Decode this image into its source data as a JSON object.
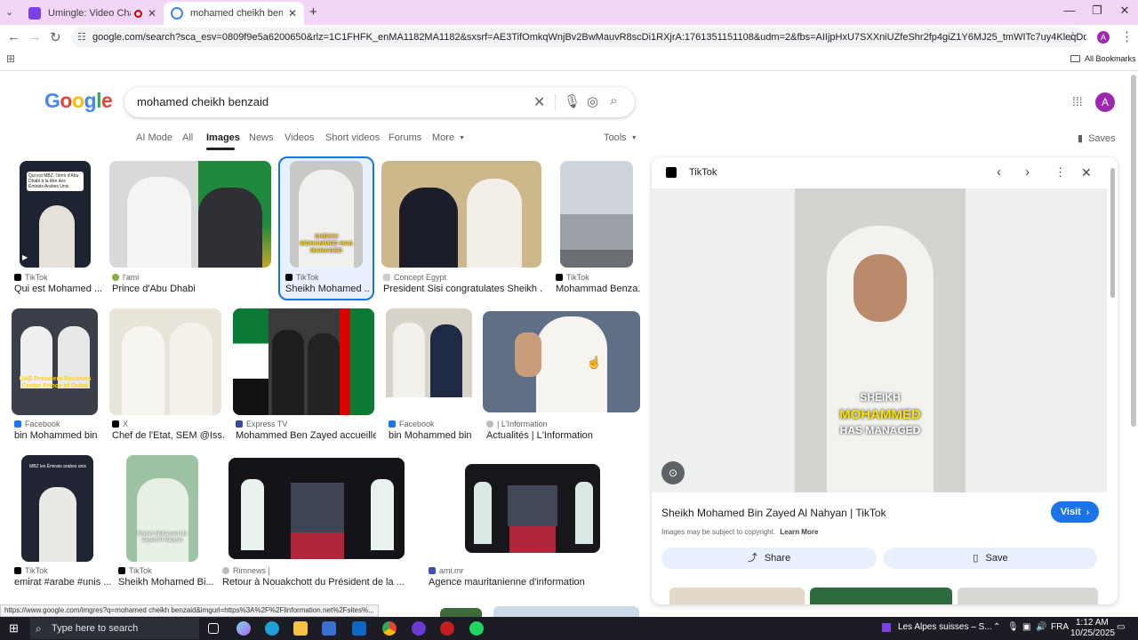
{
  "browser": {
    "tabs": [
      {
        "title": "Umingle: Video Chat with S",
        "active": false
      },
      {
        "title": "mohamed cheikh benzaid - Go",
        "active": true
      }
    ],
    "new_tab": "+",
    "url": "google.com/search?sca_esv=0809f9e5a6200650&rlz=1C1FHFK_enMA1182MA1182&sxsrf=AE3TifOmkqWnjBv2BwMauvR8scDi1RXjrA:1761351151108&udm=2&fbs=AIIjpHxU7SXXniUZfeShr2fp4giZ1Y6MJ25_tmWITc7uy4KleqDdErwP5rACeJAty2zADJjYuUnSkczEhozY...",
    "all_bookmarks": "All Bookmarks",
    "status_url": "https://www.google.com/imgres?q=mohamed cheikh benzaid&imgurl=https%3A%2F%2Flinformation.net%2Fsites%..."
  },
  "search": {
    "logo": "Google",
    "query": "mohamed cheikh benzaid",
    "avatar_letter": "A",
    "tabs": [
      "AI Mode",
      "All",
      "Images",
      "News",
      "Videos",
      "Short videos",
      "Forums",
      "More"
    ],
    "active_tab": "Images",
    "tools": "Tools",
    "saves": "Saves"
  },
  "results": [
    {
      "source": "TikTok",
      "caption": "Qui est Mohamed ...",
      "thumb_text": "Qui est MBZ, l'émir d'Abu Dhabi à la tête des Émirats Arabes Unis"
    },
    {
      "source": "l'ami",
      "caption": "Prince d'Abu Dhabi",
      "thumb_text": ""
    },
    {
      "source": "TikTok",
      "caption": "Sheikh Mohamed ...",
      "thumb_text": "SHEIKH MOHAMMED HAS MANAGED"
    },
    {
      "source": "Concept Egypt",
      "caption": "President Sisi congratulates Sheikh ...",
      "thumb_text": ""
    },
    {
      "source": "TikTok",
      "caption": "Mohammad Benza...",
      "thumb_text": ""
    },
    {
      "source": "Facebook",
      "caption": "bin Mohammed bin...",
      "thumb_text": "UAE President Receives Crown Prince of Dubai"
    },
    {
      "source": "X",
      "caption": "Chef de l'Etat, SEM @Iss...",
      "thumb_text": ""
    },
    {
      "source": "Express TV",
      "caption": "Mohammed Ben Zayed accueille ...",
      "thumb_text": ""
    },
    {
      "source": "Facebook",
      "caption": "bin Mohammed bin...",
      "thumb_text": ""
    },
    {
      "source": "| L'Information",
      "caption": "Actualités | L'Information",
      "thumb_text": ""
    },
    {
      "source": "TikTok",
      "caption": "emirat #arabe #unis ...",
      "thumb_text": "MBZ les Émirats arabes unis"
    },
    {
      "source": "TikTok",
      "caption": "Sheikh Mohamed Bi...",
      "thumb_text": "Sheikh Mohamed bin Zayed Al Nahyan"
    },
    {
      "source": "Rimnews |",
      "caption": "Retour à Nouakchott du Président de la ...",
      "thumb_text": ""
    },
    {
      "source": "ami.mr",
      "caption": "Agence mauritanienne d'information",
      "thumb_text": ""
    }
  ],
  "panel": {
    "source": "TikTok",
    "title": "Sheikh Mohamed Bin Zayed Al Nahyan | TikTok",
    "image_text_1": "SHEIKH",
    "image_text_2": "MOHAMMED",
    "image_text_3": "HAS MANAGED",
    "visit": "Visit",
    "copyright": "Images may be subject to copyright.",
    "learn_more": "Learn More",
    "share": "Share",
    "save": "Save"
  },
  "taskbar": {
    "search_placeholder": "Type here to search",
    "media": "Les Alpes suisses – S...",
    "lang": "FRA",
    "time": "1:12 AM",
    "date": "10/25/2025"
  },
  "colors": {
    "tabstrip": "#f3d6f6",
    "accent": "#1a73e8",
    "avatar": "#9c27b0",
    "taskbar": "#1c1d24"
  }
}
